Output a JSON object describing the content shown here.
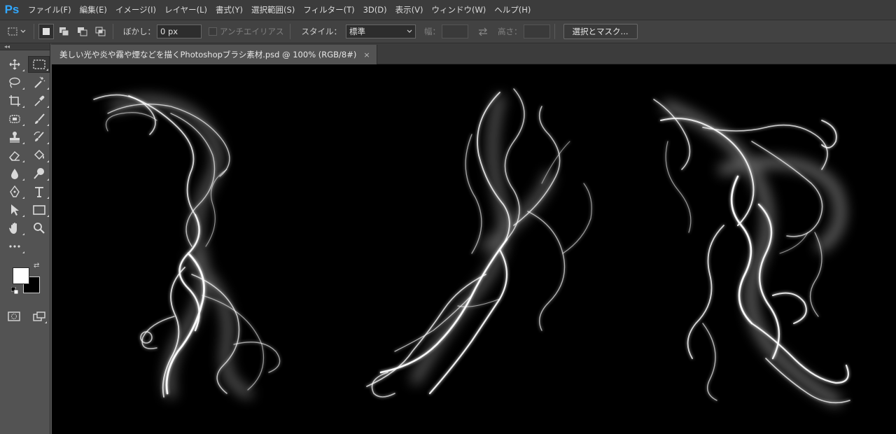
{
  "app": {
    "logo": "Ps"
  },
  "menu": [
    "ファイル(F)",
    "編集(E)",
    "イメージ(I)",
    "レイヤー(L)",
    "書式(Y)",
    "選択範囲(S)",
    "フィルター(T)",
    "3D(D)",
    "表示(V)",
    "ウィンドウ(W)",
    "ヘルプ(H)"
  ],
  "options": {
    "feather_label": "ぼかし：",
    "feather_value": "0 px",
    "antialias_label": "アンチエイリアス",
    "style_label": "スタイル：",
    "style_value": "標準",
    "width_label": "幅：",
    "height_label": "高さ：",
    "select_mask_button": "選択とマスク..."
  },
  "document": {
    "tab_title": "美しい光や炎や霧や煙などを描くPhotoshopブラシ素材.psd @ 100% (RGB/8#)",
    "close_symbol": "×"
  },
  "colors": {
    "foreground": "#ffffff",
    "background": "#000000",
    "accent": "#31a8ff"
  },
  "tools": [
    "move-icon",
    "marquee-icon",
    "lasso-icon",
    "magic-wand-icon",
    "crop-icon",
    "eyedropper-icon",
    "healing-brush-icon",
    "brush-icon",
    "stamp-icon",
    "history-brush-icon",
    "eraser-icon",
    "paint-bucket-icon",
    "blur-icon",
    "dodge-icon",
    "pen-icon",
    "type-icon",
    "path-select-icon",
    "rectangle-icon",
    "hand-icon",
    "zoom-icon",
    "more-tools-icon"
  ]
}
